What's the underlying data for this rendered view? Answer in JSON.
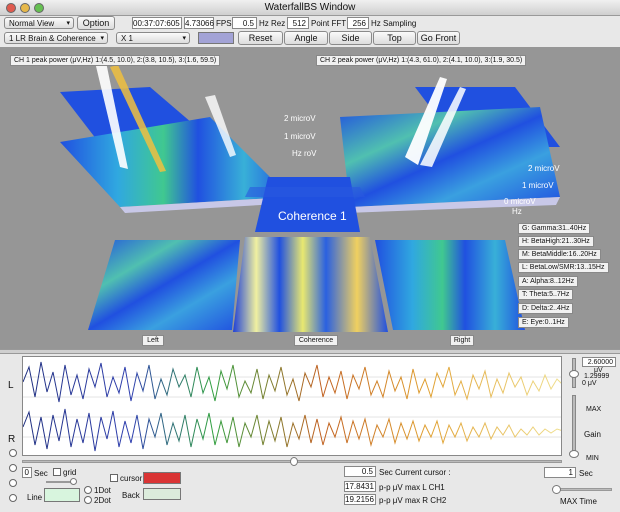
{
  "window": {
    "title": "WaterfallBS Window"
  },
  "toolbar": {
    "view_mode": "Normal View",
    "option_label": "Option",
    "time_value": "00:37:07:605",
    "fps_value": "4.73066",
    "fps_label": "FPS",
    "hz_rez_value": "0.5",
    "hz_rez_label": "Hz Rez",
    "fft_value": "512",
    "fft_label": "Point FFT",
    "sampling_value": "256",
    "sampling_label": "Hz Sampling",
    "montage": "1 LR Brain & Coherence",
    "scale": "X 1",
    "reset_label": "Reset",
    "angle_label": "Angle",
    "side_label": "Side",
    "top_label": "Top",
    "gofront_label": "Go Front"
  },
  "view": {
    "ch1_title": "CH 1 peak power (μV,Hz) 1:(4.5, 10.0), 2:(3.8, 10.5), 3:(1.6, 59.5)",
    "ch2_title": "CH 2 peak power (μV,Hz) 1:(4.3, 61.0), 2:(4.1, 10.0), 3:(1.9, 30.5)",
    "coherence_label": "Coherence 1",
    "left_y_labels": [
      "2 microV",
      "1 microV",
      "Hz roV"
    ],
    "right_y_labels": [
      "2 microV",
      "1 microV",
      "0 microV",
      "Hz"
    ],
    "bands": [
      "G: Gamma:31..40Hz",
      "H: BetaHigh:21..30Hz",
      "M: BetaMiddle:16..20Hz",
      "L: BetaLow/SMR:13..15Hz",
      "A: Alpha:8..12Hz",
      "T: Theta:5..7Hz",
      "D: Delta:2..4Hz",
      "E: Eye:0..1Hz"
    ],
    "left_label": "Left",
    "coherence_tag": "Coherence",
    "right_label": "Right"
  },
  "waves": {
    "L": "L",
    "R": "R",
    "max_uv": "2.60000",
    "uv_unit": "μV",
    "uv_mid": "1.29999",
    "zero_uv": "0 μV",
    "gain_max": "MAX",
    "gain_label": "Gain",
    "gain_min": "MIN"
  },
  "bottom": {
    "sec_value": "0",
    "sec_label": "Sec",
    "grid_label": "grid",
    "dot1_label": "1Dot",
    "dot2_label": "2Dot",
    "line_label": "Line",
    "cursor_label": "cursor",
    "back_label": "Back",
    "cursor_sec_value": "0.5",
    "current_cursor_label": "Sec Current cursor :",
    "ch1_pp_value": "17.8431",
    "ch1_pp_label": "p-p μV max L CH1",
    "ch2_pp_value": "19.2156",
    "ch2_pp_label": "p-p μV max R CH2",
    "max_time_value": "1",
    "max_time_sec": "Sec",
    "max_time_label": "MAX Time"
  },
  "colors": {
    "cursor_swatch": "#d93434",
    "line_swatch": "#d8f5de",
    "back_swatch": "#dcecdc",
    "plot_blue": "#2050e0"
  }
}
